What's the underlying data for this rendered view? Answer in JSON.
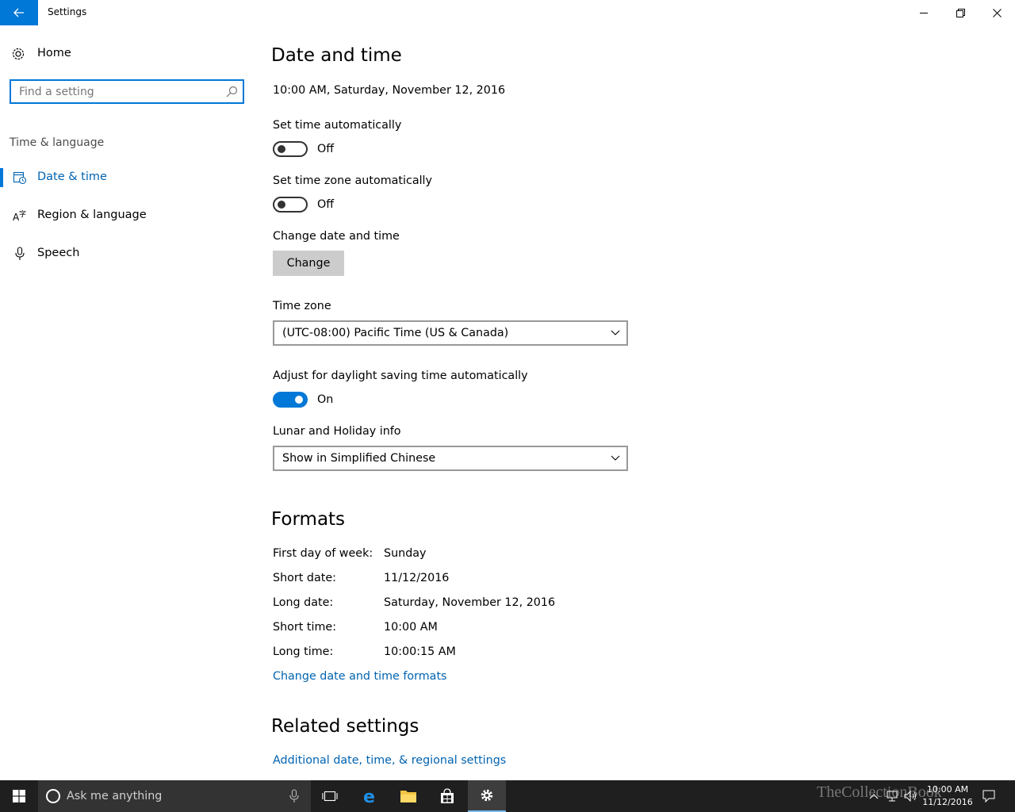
{
  "window": {
    "title": "Settings",
    "back_icon": "back-arrow-icon",
    "controls": [
      "minimize-icon",
      "restore-icon",
      "close-icon"
    ]
  },
  "sidebar": {
    "home_label": "Home",
    "search_placeholder": "Find a setting",
    "section_label": "Time & language",
    "items": [
      {
        "label": "Date & time",
        "icon": "calendar-clock-icon",
        "active": true
      },
      {
        "label": "Region & language",
        "icon": "language-icon",
        "active": false
      },
      {
        "label": "Speech",
        "icon": "microphone-icon",
        "active": false
      }
    ]
  },
  "main": {
    "heading": "Date and time",
    "current_datetime": "10:00 AM, Saturday, November 12, 2016",
    "set_time_auto": {
      "label": "Set time automatically",
      "state": "Off"
    },
    "set_timezone_auto": {
      "label": "Set time zone automatically",
      "state": "Off"
    },
    "change_datetime": {
      "label": "Change date and time",
      "button": "Change"
    },
    "time_zone": {
      "label": "Time zone",
      "value": "(UTC-08:00) Pacific Time (US & Canada)"
    },
    "daylight_saving": {
      "label": "Adjust for daylight saving time automatically",
      "state": "On"
    },
    "lunar": {
      "label": "Lunar and Holiday info",
      "value": "Show in Simplified Chinese"
    },
    "formats": {
      "heading": "Formats",
      "rows": [
        {
          "label": "First day of week:",
          "value": "Sunday"
        },
        {
          "label": "Short date:",
          "value": "11/12/2016"
        },
        {
          "label": "Long date:",
          "value": "Saturday, November 12, 2016"
        },
        {
          "label": "Short time:",
          "value": "10:00 AM"
        },
        {
          "label": "Long time:",
          "value": "10:00:15 AM"
        }
      ],
      "link": "Change date and time formats"
    },
    "related": {
      "heading": "Related settings",
      "link": "Additional date, time, & regional settings"
    }
  },
  "taskbar": {
    "search_placeholder": "Ask me anything",
    "clock_time": "10:00 AM",
    "clock_date": "11/12/2016",
    "watermark": "TheCollectionBook",
    "accent": "#0078d7"
  }
}
